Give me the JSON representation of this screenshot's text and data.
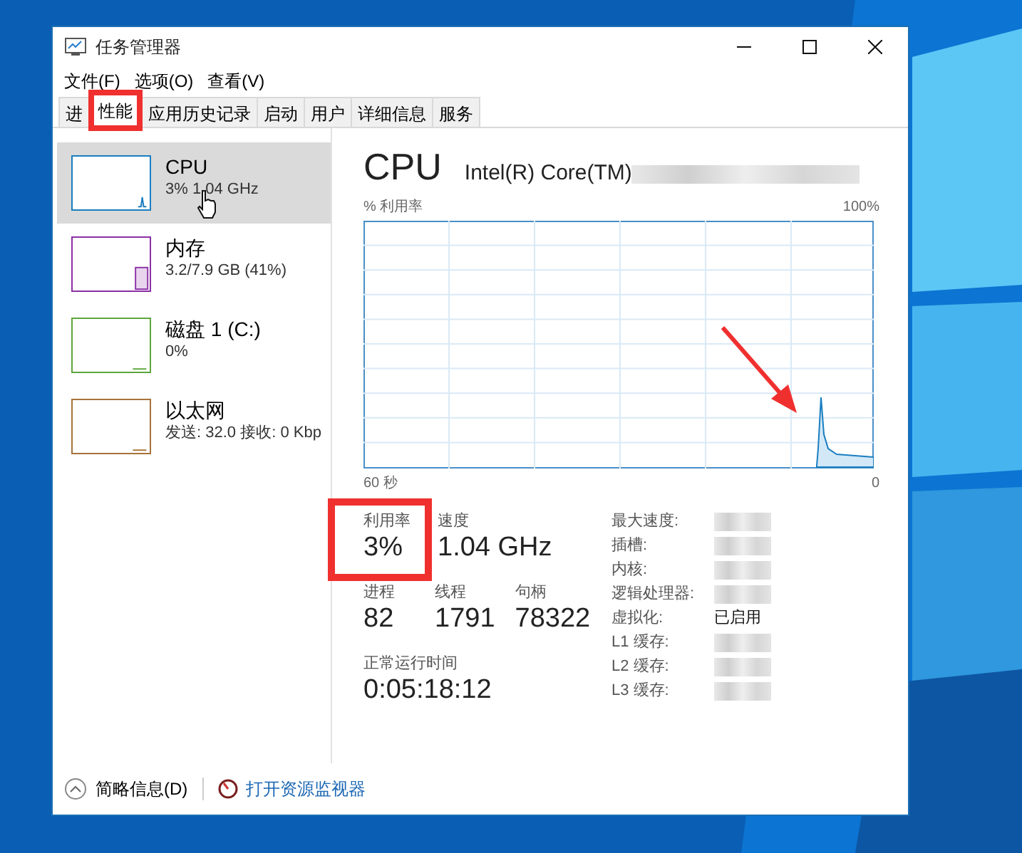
{
  "window": {
    "title": "任务管理器"
  },
  "menu": [
    "文件(F)",
    "选项(O)",
    "查看(V)"
  ],
  "tabs": [
    {
      "label": "进",
      "selected": false,
      "highlighted": false
    },
    {
      "label": "性能",
      "selected": true,
      "highlighted": true
    },
    {
      "label": "应用历史记录",
      "selected": false,
      "highlighted": false
    },
    {
      "label": "启动",
      "selected": false,
      "highlighted": false
    },
    {
      "label": "用户",
      "selected": false,
      "highlighted": false
    },
    {
      "label": "详细信息",
      "selected": false,
      "highlighted": false
    },
    {
      "label": "服务",
      "selected": false,
      "highlighted": false
    }
  ],
  "resources": [
    {
      "name": "CPU",
      "detail": "3% 1.04 GHz",
      "color": "#1a7ec0",
      "kind": "spike",
      "selected": true
    },
    {
      "name": "内存",
      "detail": "3.2/7.9 GB (41%)",
      "color": "#8b2fa5",
      "kind": "fill",
      "selected": false
    },
    {
      "name": "磁盘 1 (C:)",
      "detail": "0%",
      "color": "#5ea63b",
      "kind": "flat",
      "selected": false
    },
    {
      "name": "以太网",
      "detail": "发送: 32.0 接收: 0 Kbp",
      "color": "#a7733a",
      "kind": "flat",
      "selected": false
    }
  ],
  "panel": {
    "title": "CPU",
    "model": "Intel(R) Core(TM)",
    "model_redacted": true,
    "graph_label": "% 利用率",
    "graph_max": "100%",
    "time_span": "60 秒",
    "time_end": "0",
    "graph_pointer": true
  },
  "stats": [
    [
      {
        "label": "利用率",
        "value": "3%",
        "highlighted": true
      },
      {
        "label": "速度",
        "value": "1.04 GHz"
      }
    ],
    [
      {
        "label": "进程",
        "value": "82"
      },
      {
        "label": "线程",
        "value": "1791"
      },
      {
        "label": "句柄",
        "value": "78322"
      }
    ],
    [
      {
        "label": "正常运行时间",
        "value": "0:05:18:12"
      }
    ]
  ],
  "details": [
    {
      "label": "最大速度:",
      "redacted": true
    },
    {
      "label": "插槽:",
      "redacted": true
    },
    {
      "label": "内核:",
      "redacted": true
    },
    {
      "label": "逻辑处理器:",
      "redacted": true
    },
    {
      "label": "虚拟化:",
      "value": "已启用"
    },
    {
      "label": "L1 缓存:",
      "redacted": true
    },
    {
      "label": "L2 缓存:",
      "redacted": true
    },
    {
      "label": "L3 缓存:",
      "redacted": true
    }
  ],
  "footer": {
    "fewer_details": "简略信息(D)",
    "resource_monitor": "打开资源监视器"
  }
}
